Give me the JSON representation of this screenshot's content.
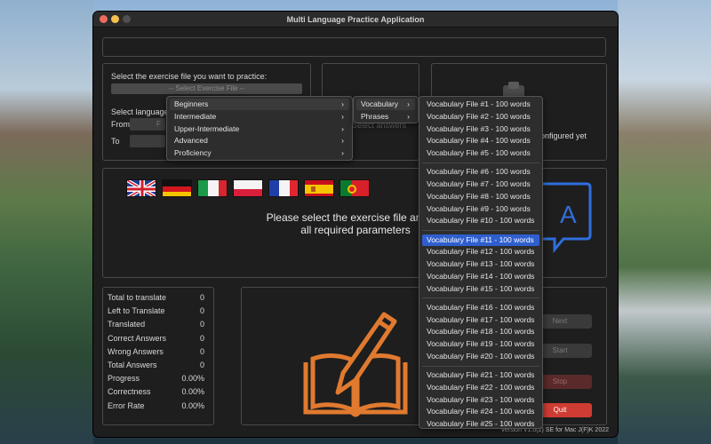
{
  "window": {
    "title": "Multi Language Practice Application"
  },
  "selection": {
    "prompt": "Select the exercise file you want to practice:",
    "dropdown_value": "-- Select Exercise File --",
    "language_label": "Select language",
    "from_label": "From",
    "from_value": "F",
    "to_label": "To"
  },
  "middle": {
    "select_answers": "Select answers"
  },
  "right": {
    "status": "onfigured yet"
  },
  "flags": [
    "uk",
    "germany",
    "italy",
    "poland",
    "france",
    "spain",
    "portugal"
  ],
  "main_prompt": {
    "line1": "Please select the exercise file and set",
    "line2": "all required parameters"
  },
  "stats": [
    {
      "label": "Total to translate",
      "value": "0"
    },
    {
      "label": "Left to Translate",
      "value": "0"
    },
    {
      "label": "Translated",
      "value": "0"
    },
    {
      "label": "Correct Answers",
      "value": "0"
    },
    {
      "label": "Wrong Answers",
      "value": "0"
    },
    {
      "label": "Total Answers",
      "value": "0"
    },
    {
      "label": "Progress",
      "value": "0.00%"
    },
    {
      "label": "Correctness",
      "value": "0.00%"
    },
    {
      "label": "Error Rate",
      "value": "0.00%"
    }
  ],
  "buttons": {
    "next": "Next",
    "start": "Start",
    "stop": "Stop",
    "quit": "Quit"
  },
  "version": "Version V1.0(2) SE for Mac J(F)K 2022",
  "menu_levels": [
    "Beginners",
    "Intermediate",
    "Upper-Intermediate",
    "Advanced",
    "Proficiency"
  ],
  "menu_types": [
    "Vocabulary",
    "Phrases"
  ],
  "vocab_groups": [
    [
      "Vocabulary File #1 - 100 words",
      "Vocabulary File #2 - 100 words",
      "Vocabulary File #3 - 100 words",
      "Vocabulary File #4 - 100 words",
      "Vocabulary File #5 - 100 words"
    ],
    [
      "Vocabulary File #6 - 100 words",
      "Vocabulary File #7 - 100 words",
      "Vocabulary File #8 - 100 words",
      "Vocabulary File #9 - 100 words",
      "Vocabulary File #10 - 100 words"
    ],
    [
      "Vocabulary File #11 - 100 words",
      "Vocabulary File #12 - 100 words",
      "Vocabulary File #13 - 100 words",
      "Vocabulary File #14 - 100 words",
      "Vocabulary File #15 - 100 words"
    ],
    [
      "Vocabulary File #16 - 100 words",
      "Vocabulary File #17 - 100 words",
      "Vocabulary File #18 - 100 words",
      "Vocabulary File #19 - 100 words",
      "Vocabulary File #20 - 100 words"
    ],
    [
      "Vocabulary File #21 - 100 words",
      "Vocabulary File #22 - 100 words",
      "Vocabulary File #23 - 100 words",
      "Vocabulary File #24 - 100 words",
      "Vocabulary File #25 - 100 words"
    ]
  ],
  "highlighted_vocab": "Vocabulary File #11 - 100 words",
  "colors": {
    "accent_orange": "#e07a2f",
    "accent_blue": "#2f6fdc",
    "highlight": "#2f5fcf",
    "quit_red": "#cf3c33"
  }
}
